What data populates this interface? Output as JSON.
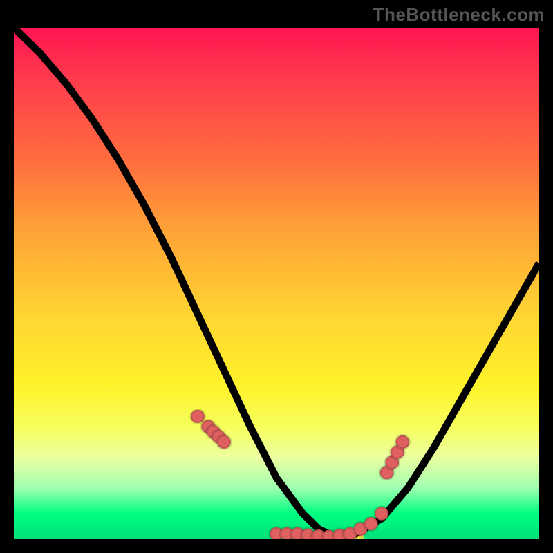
{
  "watermark": "TheBottleneck.com",
  "colors": {
    "dot": "#e06060",
    "curve": "#000000"
  },
  "chart_data": {
    "type": "line",
    "title": "",
    "xlabel": "",
    "ylabel": "",
    "xlim": [
      0,
      100
    ],
    "ylim": [
      0,
      100
    ],
    "grid": false,
    "legend": false,
    "series": [
      {
        "name": "curve",
        "x": [
          0,
          5,
          10,
          15,
          20,
          25,
          30,
          35,
          40,
          45,
          50,
          55,
          58,
          60,
          62,
          65,
          70,
          75,
          80,
          85,
          90,
          95,
          100
        ],
        "y": [
          100,
          95,
          89,
          82,
          74,
          65,
          55,
          44,
          33,
          22,
          12,
          5,
          2,
          1,
          0.5,
          1,
          4,
          10,
          18,
          27,
          36,
          45,
          54
        ]
      }
    ],
    "highlight_dots": {
      "name": "dots",
      "x": [
        35,
        37,
        38,
        39,
        40,
        50,
        52,
        54,
        56,
        58,
        60,
        62,
        64,
        66,
        68,
        70,
        71,
        72,
        73,
        74
      ],
      "y": [
        24,
        22,
        21,
        20,
        19,
        1,
        1,
        1,
        0.8,
        0.6,
        0.5,
        0.7,
        1,
        2,
        3,
        5,
        13,
        15,
        17,
        19
      ]
    },
    "hatch_region": {
      "x_start": 60,
      "x_end": 66,
      "baseline_y": 0
    }
  }
}
